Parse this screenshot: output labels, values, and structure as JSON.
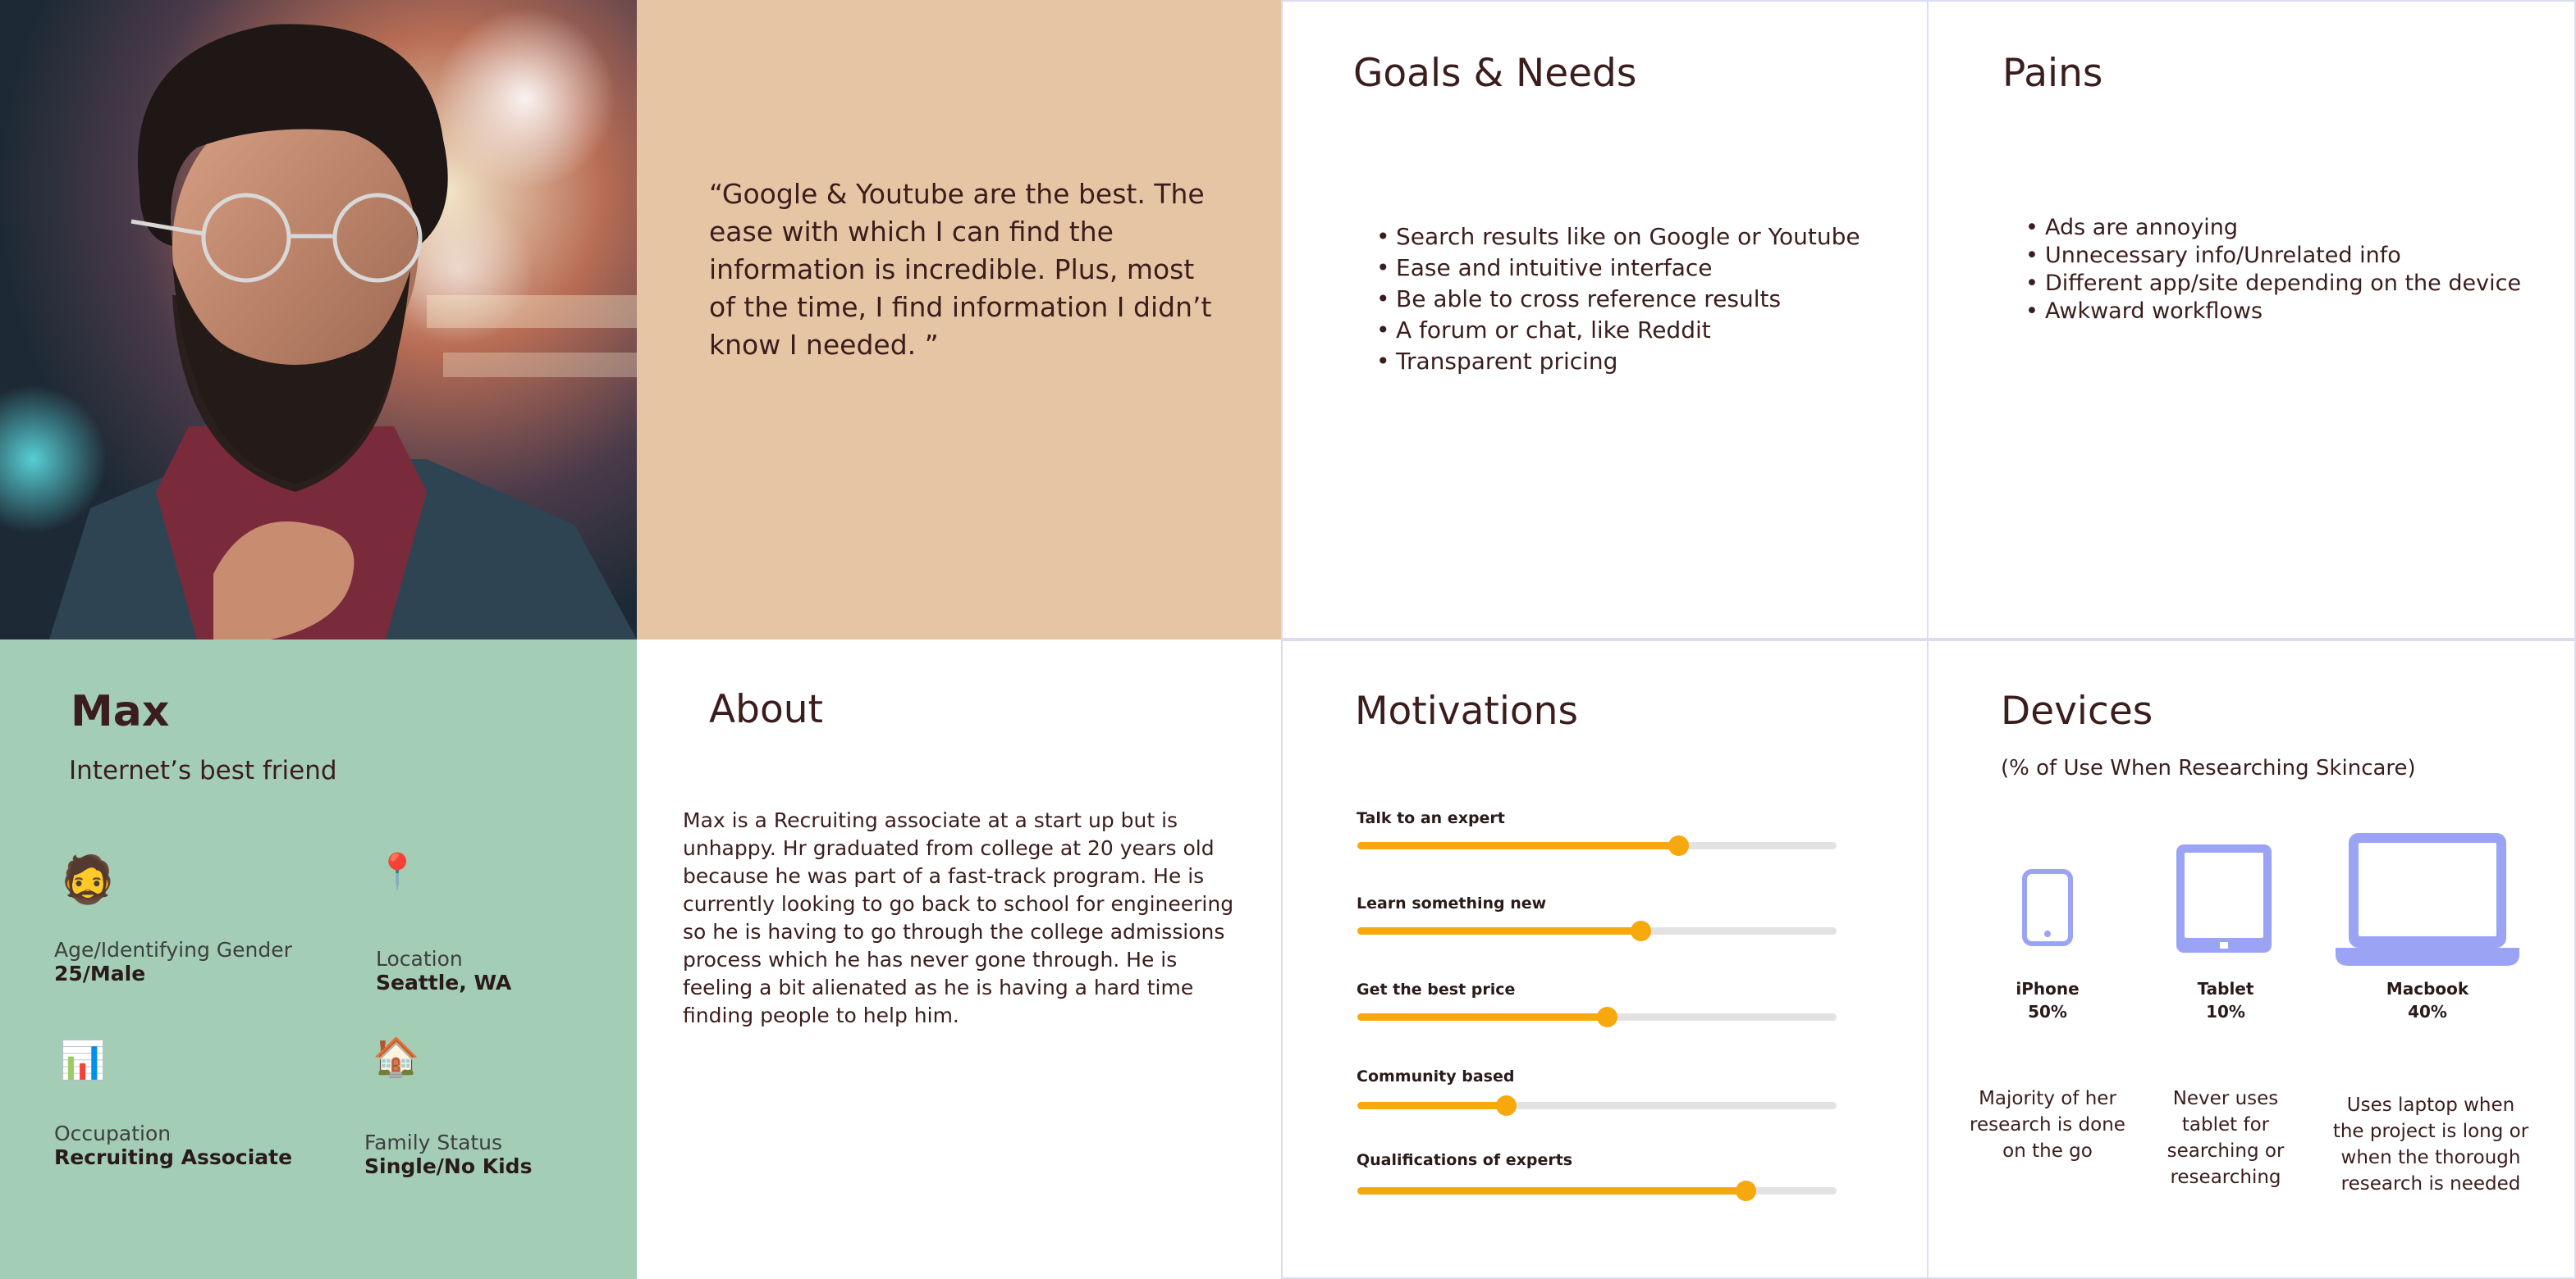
{
  "quote": {
    "text": "“Google & Youtube are the best. The ease with which I can find the information is incredible. Plus, most of the time, I find information I didn’t know I needed. ”"
  },
  "goals": {
    "title": "Goals & Needs",
    "items": [
      "Search results like on Google or Youtube",
      "Ease and intuitive interface",
      "Be able to cross reference results",
      "A forum or chat, like Reddit",
      "Transparent pricing"
    ]
  },
  "pains": {
    "title": "Pains",
    "items": [
      "Ads are annoying",
      "Unnecessary info/Unrelated info",
      "Different app/site depending on the device",
      "Awkward workflows"
    ]
  },
  "profile": {
    "name": "Max",
    "tagline": "Internet’s best friend",
    "attributes": [
      {
        "icon": "bearded-man-icon",
        "glyph": "🧔",
        "label": "Age/Identifying Gender",
        "value": "25/Male"
      },
      {
        "icon": "pin-icon",
        "glyph": "📍",
        "label": "Location",
        "value": "Seattle, WA"
      },
      {
        "icon": "bar-chart-icon",
        "glyph": "📊",
        "label": "Occupation",
        "value": "Recruiting Associate"
      },
      {
        "icon": "house-icon",
        "glyph": "🏠",
        "label": "Family Status",
        "value": "Single/No Kids"
      }
    ]
  },
  "about": {
    "title": "About",
    "text": "Max is a Recruiting associate at a start up but is unhappy. Hr graduated from college at 20 years old because he was part of a fast-track program. He is currently looking to go back to school for engineering so he is having to go through the college admissions process which he has never gone through. He is feeling a bit alienated as he is having a hard time finding people to help him."
  },
  "motivations": {
    "title": "Motivations",
    "accent": "#f7a80d",
    "track": "#e2e2e2",
    "items": [
      {
        "label": "Talk to an expert",
        "level": 0.67
      },
      {
        "label": "Learn something new",
        "level": 0.59
      },
      {
        "label": "Get the best price",
        "level": 0.52
      },
      {
        "label": "Community based",
        "level": 0.31
      },
      {
        "label": "Qualifications of experts",
        "level": 0.81
      }
    ]
  },
  "devices": {
    "title": "Devices",
    "subtitle": "(% of Use When Researching Skincare)",
    "accent": "#9ba3f5",
    "items": [
      {
        "icon": "phone-icon",
        "name": "iPhone",
        "percent": "50%",
        "description": "Majority of her research is done on the go"
      },
      {
        "icon": "tablet-icon",
        "name": "Tablet",
        "percent": "10%",
        "description": "Never uses tablet for searching or researching"
      },
      {
        "icon": "laptop-icon",
        "name": "Macbook",
        "percent": "40%",
        "description": "Uses laptop when the project is long or when the thorough research is needed"
      }
    ]
  }
}
